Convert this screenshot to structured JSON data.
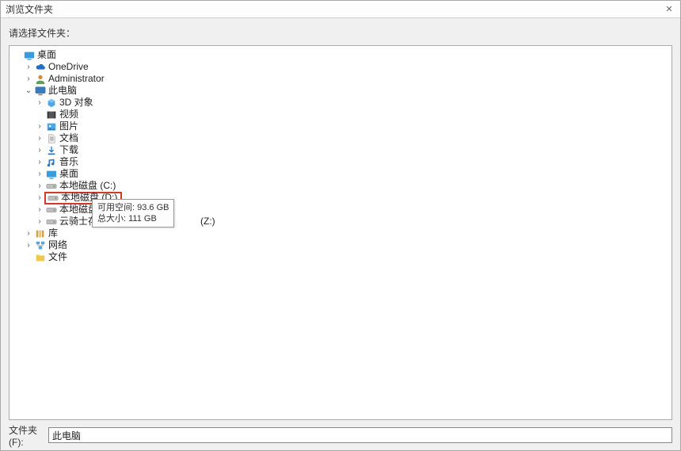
{
  "window": {
    "title": "浏览文件夹",
    "prompt": "请选择文件夹：",
    "close_glyph": "✕"
  },
  "tree": {
    "desktop": {
      "label": "桌面",
      "expander": ""
    },
    "onedrive": {
      "label": "OneDrive",
      "expander": "›"
    },
    "admin": {
      "label": "Administrator",
      "expander": "›"
    },
    "thispc": {
      "label": "此电脑",
      "expander": "⌄"
    },
    "objects3d": {
      "label": "3D 对象",
      "expander": "›"
    },
    "videos": {
      "label": "视频",
      "expander": ""
    },
    "pictures": {
      "label": "图片",
      "expander": "›"
    },
    "documents": {
      "label": "文档",
      "expander": "›"
    },
    "downloads": {
      "label": "下载",
      "expander": "›"
    },
    "music": {
      "label": "音乐",
      "expander": "›"
    },
    "desktop2": {
      "label": "桌面",
      "expander": "›"
    },
    "drive_c": {
      "label": "本地磁盘 (C:)",
      "expander": "›"
    },
    "drive_d": {
      "label": "本地磁盘 (D:)",
      "expander": "›"
    },
    "drive_e": {
      "label": "本地磁盘 (E:)",
      "expander": "›"
    },
    "drive_z": {
      "label": "云骑士存储十",
      "expander": "›",
      "suffix": "(Z:)"
    },
    "libraries": {
      "label": "库",
      "expander": "›"
    },
    "network": {
      "label": "网络",
      "expander": "›"
    },
    "files": {
      "label": "文件",
      "expander": ""
    }
  },
  "tooltip": {
    "line1": "可用空间: 93.6 GB",
    "line2": "总大小: 111 GB"
  },
  "footer": {
    "label": "文件夹(F):",
    "value": "此电脑"
  }
}
